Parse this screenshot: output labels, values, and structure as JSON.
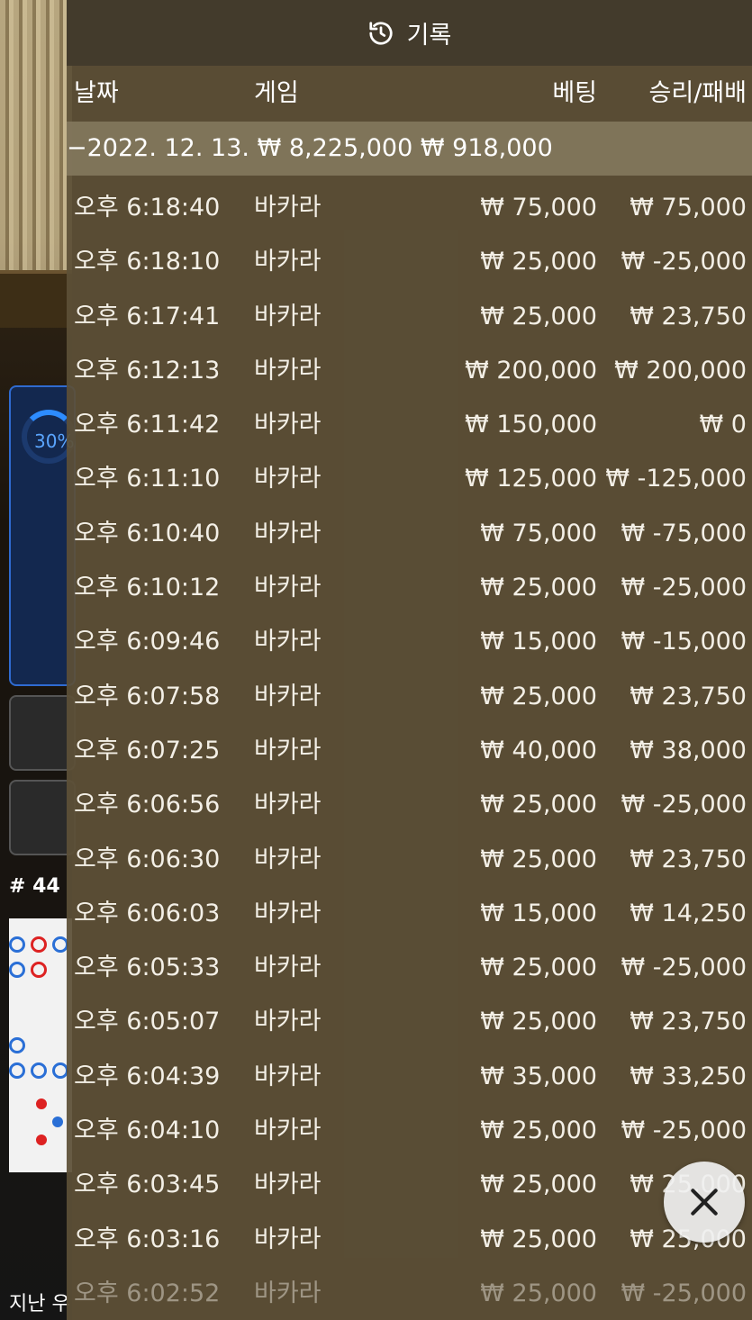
{
  "background": {
    "progress_label": "30%",
    "round_label": "# 44",
    "bottom_label": "지난 우"
  },
  "history": {
    "title": "기록",
    "columns": {
      "date": "날짜",
      "game": "게임",
      "bet": "베팅",
      "result": "승리/패배"
    },
    "date_group": {
      "date": "−2022. 12. 13.",
      "total_bet": "₩ 8,225,000",
      "total_result": "₩ 918,000"
    },
    "rows": [
      {
        "time": "오후 6:18:40",
        "game": "바카라",
        "bet": "₩ 75,000",
        "result": "₩ 75,000"
      },
      {
        "time": "오후 6:18:10",
        "game": "바카라",
        "bet": "₩ 25,000",
        "result": "₩ -25,000"
      },
      {
        "time": "오후 6:17:41",
        "game": "바카라",
        "bet": "₩ 25,000",
        "result": "₩ 23,750"
      },
      {
        "time": "오후 6:12:13",
        "game": "바카라",
        "bet": "₩ 200,000",
        "result": "₩ 200,000"
      },
      {
        "time": "오후 6:11:42",
        "game": "바카라",
        "bet": "₩ 150,000",
        "result": "₩ 0"
      },
      {
        "time": "오후 6:11:10",
        "game": "바카라",
        "bet": "₩ 125,000",
        "result": "₩ -125,000"
      },
      {
        "time": "오후 6:10:40",
        "game": "바카라",
        "bet": "₩ 75,000",
        "result": "₩ -75,000"
      },
      {
        "time": "오후 6:10:12",
        "game": "바카라",
        "bet": "₩ 25,000",
        "result": "₩ -25,000"
      },
      {
        "time": "오후 6:09:46",
        "game": "바카라",
        "bet": "₩ 15,000",
        "result": "₩ -15,000"
      },
      {
        "time": "오후 6:07:58",
        "game": "바카라",
        "bet": "₩ 25,000",
        "result": "₩ 23,750"
      },
      {
        "time": "오후 6:07:25",
        "game": "바카라",
        "bet": "₩ 40,000",
        "result": "₩ 38,000"
      },
      {
        "time": "오후 6:06:56",
        "game": "바카라",
        "bet": "₩ 25,000",
        "result": "₩ -25,000"
      },
      {
        "time": "오후 6:06:30",
        "game": "바카라",
        "bet": "₩ 25,000",
        "result": "₩ 23,750"
      },
      {
        "time": "오후 6:06:03",
        "game": "바카라",
        "bet": "₩ 15,000",
        "result": "₩ 14,250"
      },
      {
        "time": "오후 6:05:33",
        "game": "바카라",
        "bet": "₩ 25,000",
        "result": "₩ -25,000"
      },
      {
        "time": "오후 6:05:07",
        "game": "바카라",
        "bet": "₩ 25,000",
        "result": "₩ 23,750"
      },
      {
        "time": "오후 6:04:39",
        "game": "바카라",
        "bet": "₩ 35,000",
        "result": "₩ 33,250"
      },
      {
        "time": "오후 6:04:10",
        "game": "바카라",
        "bet": "₩ 25,000",
        "result": "₩ -25,000"
      },
      {
        "time": "오후 6:03:45",
        "game": "바카라",
        "bet": "₩ 25,000",
        "result": "₩ 25,000"
      },
      {
        "time": "오후 6:03:16",
        "game": "바카라",
        "bet": "₩ 25,000",
        "result": "₩ 25,000"
      },
      {
        "time": "오후 6:02:52",
        "game": "바카라",
        "bet": "₩ 25,000",
        "result": "₩ -25,000"
      }
    ]
  },
  "icons": {
    "header": "history-icon",
    "close": "close-icon"
  }
}
